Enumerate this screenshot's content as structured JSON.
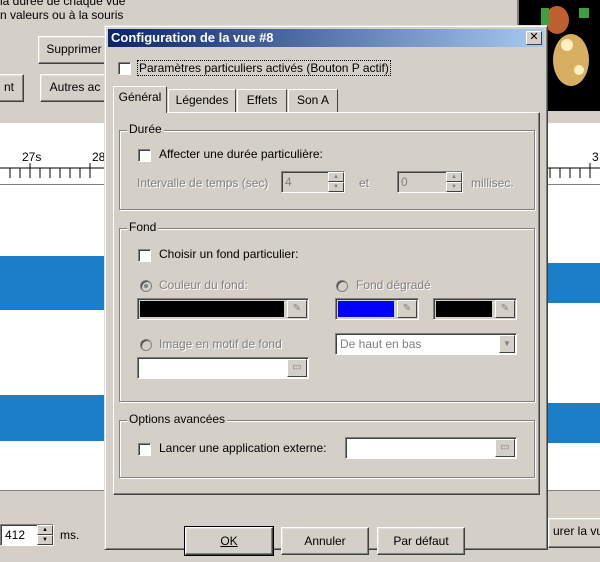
{
  "background": {
    "top_text": "la durée de chaque vue",
    "second_text": "n valeurs ou à la souris",
    "btn_supprimer": "Supprimer",
    "btn_nt": "nt",
    "btn_autres": "Autres ac",
    "ruler_labels": [
      "27s",
      "28",
      "3"
    ],
    "ms_value": "412",
    "ms_unit": "ms.",
    "btn_right": "urer la vu"
  },
  "dialog": {
    "title": "Configuration de la vue #8",
    "close_glyph": "✕",
    "special_params_label": "Paramètres particuliers activés (Bouton P actif)",
    "tabs": [
      {
        "label": "Général"
      },
      {
        "label": "Légendes"
      },
      {
        "label": "Effets"
      },
      {
        "label": "Son A"
      }
    ],
    "duree": {
      "title": "Durée",
      "checkbox_label": "Affecter une durée particulière:",
      "interval_label": "Intervalle de temps (sec)",
      "seconds_value": "4",
      "et_label": "et",
      "ms_value": "0",
      "millisec_label": "millisec."
    },
    "fond": {
      "title": "Fond",
      "checkbox_label": "Choisir un fond particulier:",
      "radio_couleur": "Couleur du fond:",
      "radio_degrade": "Fond dégradé",
      "radio_image": "Image en motif de fond",
      "color_main": "#000000",
      "color_grad1": "#0000ff",
      "color_grad2": "#000000",
      "gradient_direction": "De haut en bas"
    },
    "options": {
      "title": "Options avancées",
      "checkbox_label": "Lancer une application externe:"
    },
    "buttons": {
      "ok": "OK",
      "cancel": "Annuler",
      "default": "Par défaut"
    }
  }
}
